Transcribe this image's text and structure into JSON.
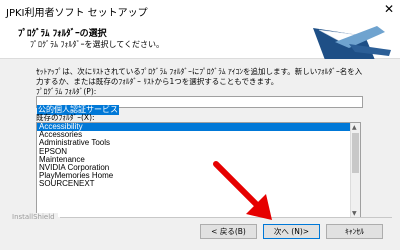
{
  "window": {
    "title": "JPKI利用者ソフト セットアップ",
    "close_glyph": "✕"
  },
  "header": {
    "title": "ﾌﾟﾛｸﾞﾗﾑ ﾌｫﾙﾀﾞｰの選択",
    "subtitle": "ﾌﾟﾛｸﾞﾗﾑ ﾌｫﾙﾀﾞｰを選択してください。"
  },
  "description": "ｾｯﾄｱｯﾌﾟは、次にﾘｽﾄされているﾌﾟﾛｸﾞﾗﾑ ﾌｫﾙﾀﾞｰにﾌﾟﾛｸﾞﾗﾑ ｱｲｺﾝを追加します。新しいﾌｫﾙﾀﾞｰ名を入力するか、または既存のﾌｫﾙﾀﾞｰ ﾘｽﾄから1つを選択することもできます。",
  "program_folder": {
    "label": "ﾌﾟﾛｸﾞﾗﾑ ﾌｫﾙﾀﾞ(P):",
    "value": "公的個人認証サービス"
  },
  "existing_folders": {
    "label": "既存のﾌｫﾙﾀﾞｰ(X):",
    "items": [
      "Accessibility",
      "Accessories",
      "Administrative Tools",
      "EPSON",
      "Maintenance",
      "NVIDIA Corporation",
      "PlayMemories Home",
      "SOURCENEXT"
    ],
    "selected_index": 0
  },
  "footer": {
    "brand": "InstallShield"
  },
  "buttons": {
    "back": "< 戻る(B)",
    "next": "次へ (N)>",
    "cancel": "ｷｬﾝｾﾙ"
  },
  "colors": {
    "selection": "#0078d7",
    "arrow": "#e60000"
  }
}
